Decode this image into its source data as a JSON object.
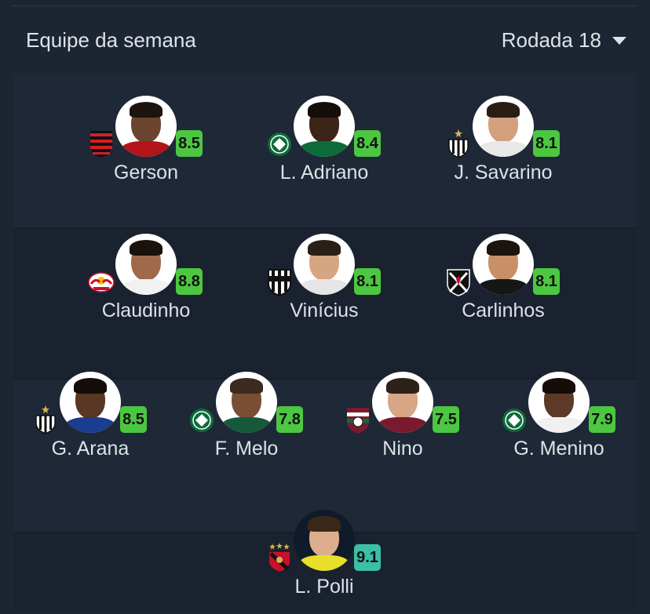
{
  "header": {
    "title": "Equipe da semana",
    "round_label": "Rodada 18"
  },
  "players": [
    {
      "name": "Gerson",
      "rating": "8.5",
      "club": "flamengo-crest-icon"
    },
    {
      "name": "L. Adriano",
      "rating": "8.4",
      "club": "palmeiras-crest-icon"
    },
    {
      "name": "J. Savarino",
      "rating": "8.1",
      "club": "atletico-mg-crest-icon"
    },
    {
      "name": "Claudinho",
      "rating": "8.8",
      "club": "red-bull-bragantino-crest-icon"
    },
    {
      "name": "Vinícius",
      "rating": "8.1",
      "club": "ceara-crest-icon"
    },
    {
      "name": "Carlinhos",
      "rating": "8.1",
      "club": "vasco-crest-icon"
    },
    {
      "name": "G. Arana",
      "rating": "8.5",
      "club": "atletico-mg-crest-icon"
    },
    {
      "name": "F. Melo",
      "rating": "7.8",
      "club": "palmeiras-crest-icon"
    },
    {
      "name": "Nino",
      "rating": "7.5",
      "club": "fluminense-crest-icon"
    },
    {
      "name": "G. Menino",
      "rating": "7.9",
      "club": "palmeiras-crest-icon"
    },
    {
      "name": "L. Polli",
      "rating": "9.1",
      "club": "sport-recife-crest-icon"
    }
  ],
  "colors": {
    "background": "#1c2532",
    "rating_badge": "#4cc741",
    "best_rating_badge": "#3bbfa6"
  }
}
